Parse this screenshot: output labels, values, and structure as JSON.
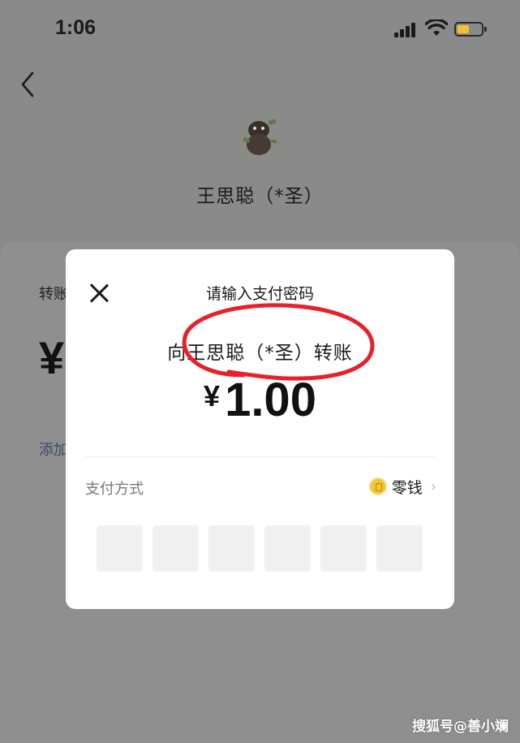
{
  "status_bar": {
    "time": "1:06"
  },
  "header": {
    "payee_name": "王思聪（*圣）"
  },
  "background_sheet": {
    "label_partial": "转账",
    "currency_partial": "¥",
    "link_partial": "添加"
  },
  "modal": {
    "title": "请输入支付密码",
    "payee_line": "向王思聪（*圣）转账",
    "currency": "¥",
    "amount": "1.00",
    "payment_method_label": "支付方式",
    "payment_method_value": "零钱",
    "pin_boxes": [
      "",
      "",
      "",
      "",
      "",
      ""
    ]
  },
  "watermark": "搜狐号@善小斓",
  "colors": {
    "annotation_circle": "#e8202a",
    "coin": "#f4c52f"
  },
  "icons": [
    "signal-icon",
    "wifi-icon",
    "battery-icon",
    "back-arrow-icon",
    "close-icon",
    "coin-icon",
    "chevron-right-icon"
  ]
}
